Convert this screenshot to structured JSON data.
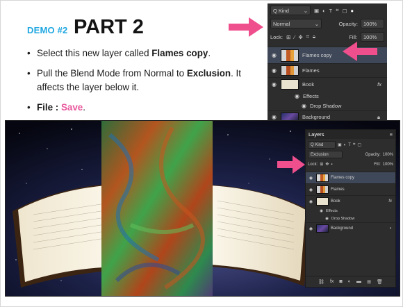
{
  "header": {
    "demo_tag": "DEMO #2",
    "part": "PART 2"
  },
  "steps": [
    {
      "pre": "Select this new layer called ",
      "bold": "Flames copy",
      "post": "."
    },
    {
      "pre": "Pull the Blend Mode from Normal to ",
      "bold": "Exclusion",
      "post": ". It affects the layer below it."
    },
    {
      "bold": "File : ",
      "pink": "Save",
      "post": "."
    }
  ],
  "panel_top": {
    "kind_label": "Q Kind",
    "blend_mode": "Normal",
    "opacity_label": "Opacity:",
    "opacity_value": "100%",
    "lock_label": "Lock:",
    "fill_label": "Fill:",
    "fill_value": "100%",
    "layers": [
      {
        "name": "Flames copy"
      },
      {
        "name": "Flames"
      },
      {
        "name": "Book",
        "fx": "fx"
      },
      {
        "name": "Effects"
      },
      {
        "name": "Drop Shadow"
      },
      {
        "name": "Background"
      }
    ]
  },
  "panel_bottom": {
    "tab_label": "Layers",
    "kind_label": "Q Kind",
    "blend_mode": "Exclusion",
    "opacity_label": "Opacity:",
    "opacity_value": "100%",
    "lock_label": "Lock:",
    "fill_label": "Fill:",
    "fill_value": "100%",
    "layers": [
      {
        "name": "Flames copy"
      },
      {
        "name": "Flames"
      },
      {
        "name": "Book",
        "fx": "fx"
      },
      {
        "name": "Effects"
      },
      {
        "name": "Drop Shadow"
      },
      {
        "name": "Background"
      }
    ],
    "footer_icons": [
      "link-icon",
      "fx-icon",
      "mask-icon",
      "adjustment-icon",
      "folder-icon",
      "new-layer-icon",
      "trash-icon"
    ]
  },
  "colors": {
    "accent_blue": "#1ea7e1",
    "accent_pink": "#e9569c",
    "arrow_pink": "#ef4f8c",
    "panel_bg": "#2d2d2d",
    "selected_row": "#3f4858"
  }
}
